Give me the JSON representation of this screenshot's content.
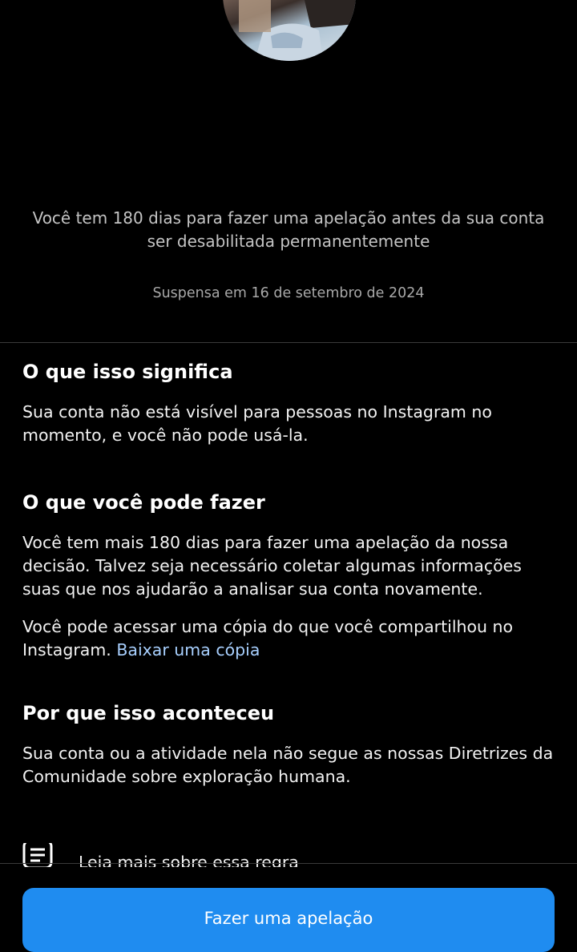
{
  "header": {
    "notice": "Você tem 180 dias para fazer uma apelação antes da sua conta ser desabilitada permanentemente",
    "suspended_date": "Suspensa em 16 de setembro de 2024"
  },
  "sections": {
    "meaning": {
      "title": "O que isso significa",
      "body": "Sua conta não está visível para pessoas no Instagram no momento, e você não pode usá-la."
    },
    "actions": {
      "title": "O que você pode fazer",
      "body": "Você tem mais 180 dias para fazer uma apelação da nossa decisão. Talvez seja necessário coletar algumas informações suas que nos ajudarão a analisar sua conta novamente.",
      "download_text": "Você pode acessar uma cópia do que você compartilhou no Instagram.",
      "download_link": "Baixar uma cópia"
    },
    "reason": {
      "title": "Por que isso aconteceu",
      "body": "Sua conta ou a atividade nela não segue as nossas Diretrizes da Comunidade sobre exploração humana.",
      "read_more_icon": "document-lines-icon",
      "read_more": "Leia mais sobre essa regra"
    }
  },
  "footer": {
    "appeal_button": "Fazer uma apelação"
  },
  "colors": {
    "background": "#000000",
    "link": "#a8d0ff",
    "button": "#1f8cf0"
  }
}
